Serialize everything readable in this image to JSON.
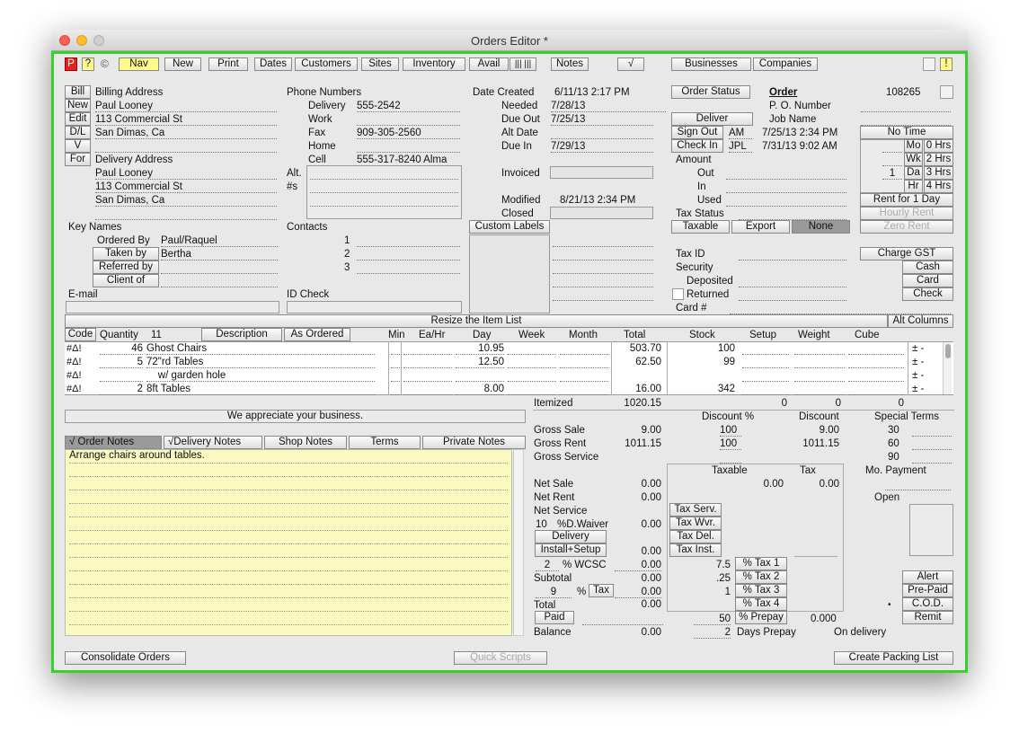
{
  "title": "Orders Editor *",
  "toolbar": {
    "p": "P",
    "q": "?",
    "c": "©",
    "nav": "Nav",
    "new": "New",
    "print": "Print",
    "dates": "Dates",
    "customers": "Customers",
    "sites": "Sites",
    "inventory": "Inventory",
    "avail": "Avail",
    "bars": "||| |||",
    "notes": "Notes",
    "check": "√",
    "businesses": "Businesses",
    "companies": "Companies",
    "warn": "!"
  },
  "billing": {
    "side_buttons": [
      "Bill",
      "New",
      "Edit",
      "D/L",
      "V",
      "For"
    ],
    "label": "Billing Address",
    "lines": [
      "Paul Looney",
      "113 Commercial St",
      "San Dimas, Ca",
      ""
    ],
    "delivery_label": "Delivery Address",
    "delivery_lines": [
      "Paul Looney",
      "113 Commercial St",
      "San Dimas, Ca",
      ""
    ]
  },
  "phones": {
    "label": "Phone Numbers",
    "rows": [
      {
        "label": "Delivery",
        "value": "555-2542"
      },
      {
        "label": "Work",
        "value": ""
      },
      {
        "label": "Fax",
        "value": "909-305-2560"
      },
      {
        "label": "Home",
        "value": ""
      },
      {
        "label": "Cell",
        "value": "555-317-8240 Alma"
      }
    ],
    "alt": "Alt.",
    "alt2": "#s"
  },
  "dates": {
    "created_label": "Date Created",
    "created": "6/11/13 2:17 PM",
    "needed_label": "Needed",
    "needed": "7/28/13",
    "dueout_label": "Due Out",
    "dueout": "7/25/13",
    "altdate_label": "Alt Date",
    "altdate": "",
    "duein_label": "Due In",
    "duein": "7/29/13",
    "invoiced_label": "Invoiced",
    "modified_label": "Modified",
    "modified": "8/21/13 2:34 PM",
    "closed_label": "Closed"
  },
  "status": {
    "order_status": "Order Status",
    "deliver": "Deliver",
    "sign_out": "Sign Out",
    "sign_out_by": "AM",
    "sign_out_time": "7/25/13 2:34 PM",
    "check_in": "Check In",
    "check_in_by": "JPL",
    "check_in_time": "7/31/13 9:02 AM",
    "amount": "Amount",
    "out": "Out",
    "in": "In",
    "used": "Used",
    "tax_status": "Tax Status",
    "taxable": "Taxable",
    "export": "Export",
    "none": "None",
    "tax_id": "Tax ID",
    "security": "Security",
    "deposited": "Deposited",
    "returned": "Returned",
    "card_no": "Card #"
  },
  "order": {
    "label": "Order",
    "number": "108265",
    "po": "P. O. Number",
    "job": "Job Name",
    "no_time": "No Time",
    "periods": [
      {
        "qty": "",
        "unit": "Mo",
        "hrs": "0 Hrs"
      },
      {
        "qty": "",
        "unit": "Wk",
        "hrs": "2 Hrs"
      },
      {
        "qty": "1",
        "unit": "Da",
        "hrs": "3 Hrs"
      },
      {
        "qty": "",
        "unit": "Hr",
        "hrs": "4 Hrs"
      }
    ],
    "rent_day": "Rent for 1 Day",
    "hourly": "Hourly Rent",
    "zero": "Zero Rent",
    "charge_gst": "Charge GST",
    "cash": "Cash",
    "card": "Card",
    "check": "Check"
  },
  "keynames": {
    "label": "Key Names",
    "rows": [
      {
        "label": "Ordered By",
        "value": "Paul/Raquel"
      },
      {
        "label": "Taken by",
        "value": "Bertha"
      },
      {
        "label": "Referred by",
        "value": ""
      },
      {
        "label": "Client of",
        "value": ""
      }
    ],
    "contacts": "Contacts",
    "email": "E-mail",
    "id_check": "ID Check",
    "custom": "Custom Labels"
  },
  "items": {
    "resize": "Resize the Item List",
    "alt_columns": "Alt Columns",
    "headers": {
      "code": "Code",
      "quantity": "Quantity",
      "count": "11",
      "description": "Description",
      "as_ordered": "As Ordered",
      "min": "Min",
      "eahr": "Ea/Hr",
      "day": "Day",
      "week": "Week",
      "month": "Month",
      "total": "Total",
      "stock": "Stock",
      "setup": "Setup",
      "weight": "Weight",
      "cube": "Cube"
    },
    "rows": [
      {
        "qty": "46",
        "desc": "Ghost Chairs",
        "day": "10.95",
        "total": "503.70",
        "stock": "100"
      },
      {
        "qty": "5",
        "desc": "72\"rd Tables",
        "day": "12.50",
        "total": "62.50",
        "stock": "99"
      },
      {
        "qty": "",
        "desc": "    w/ garden hole",
        "day": "",
        "total": "",
        "stock": ""
      },
      {
        "qty": "2",
        "desc": "8ft Tables",
        "day": "8.00",
        "total": "16.00",
        "stock": "342"
      }
    ],
    "itemized_label": "Itemized",
    "itemized": "1020.15",
    "zero1": "0",
    "zero2": "0",
    "zero3": "0"
  },
  "message": "We appreciate your business.",
  "tabs": [
    "√  Order Notes",
    "√Delivery Notes",
    "Shop Notes",
    "Terms",
    "Private Notes"
  ],
  "notes_text": "Arrange chairs around tables.",
  "totals": {
    "discount_pct": "Discount %",
    "discount": "Discount",
    "special": "Special Terms",
    "gross_sale": "Gross Sale",
    "gross_sale_v": "9.00",
    "gs_pct": "100",
    "gs_disc": "9.00",
    "gross_rent": "Gross Rent",
    "gross_rent_v": "1011.15",
    "gr_pct": "100",
    "gr_disc": "1011.15",
    "gross_service": "Gross Service",
    "terms": [
      "30",
      "60",
      "90"
    ],
    "taxable_h": "Taxable",
    "tax_h": "Tax",
    "mo_payment": "Mo. Payment",
    "open": "Open",
    "net_sale": "Net Sale",
    "net_sale_v": "0.00",
    "net_sale_t": "0.00",
    "net_sale_x": "0.00",
    "net_rent": "Net Rent",
    "net_rent_v": "0.00",
    "net_service": "Net Service",
    "waiver_pct": "10",
    "waiver": "%D.Waiver",
    "waiver_v": "0.00",
    "delivery": "Delivery",
    "install": "Install+Setup",
    "install_v": "0.00",
    "wcsc_pct": "2",
    "wcsc": "% WCSC",
    "wcsc_v": "0.00",
    "subtotal": "Subtotal",
    "subtotal_v": "0.00",
    "tax_pct": "9",
    "tax_btn": "Tax",
    "tax_v": "0.00",
    "total": "Total",
    "total_v": "0.00",
    "paid": "Paid",
    "balance": "Balance",
    "balance_v": "0.00",
    "tax_serv": "Tax Serv.",
    "tax_wvr": "Tax Wvr.",
    "tax_del": "Tax Del.",
    "tax_inst": "Tax Inst.",
    "rates": [
      "7.5",
      ".25",
      "1",
      ""
    ],
    "tax_buttons": [
      "% Tax 1",
      "% Tax 2",
      "% Tax 3",
      "% Tax 4"
    ],
    "prepay_pct": "50",
    "prepay": "% Prepay",
    "prepay_v": "0.000",
    "days": "2",
    "days_prepay": "Days Prepay",
    "on_delivery": "On delivery",
    "alert": "Alert",
    "prepaid": "Pre-Paid",
    "cod": "C.O.D.",
    "remit": "Remit"
  },
  "bottom": {
    "consolidate": "Consolidate Orders",
    "quick": "Quick Scripts",
    "packing": "Create Packing List"
  },
  "colors": {
    "frame": "#36d12e",
    "nav": "#fffa8c",
    "notes_bg": "#fafac0",
    "red": "#e82020"
  }
}
